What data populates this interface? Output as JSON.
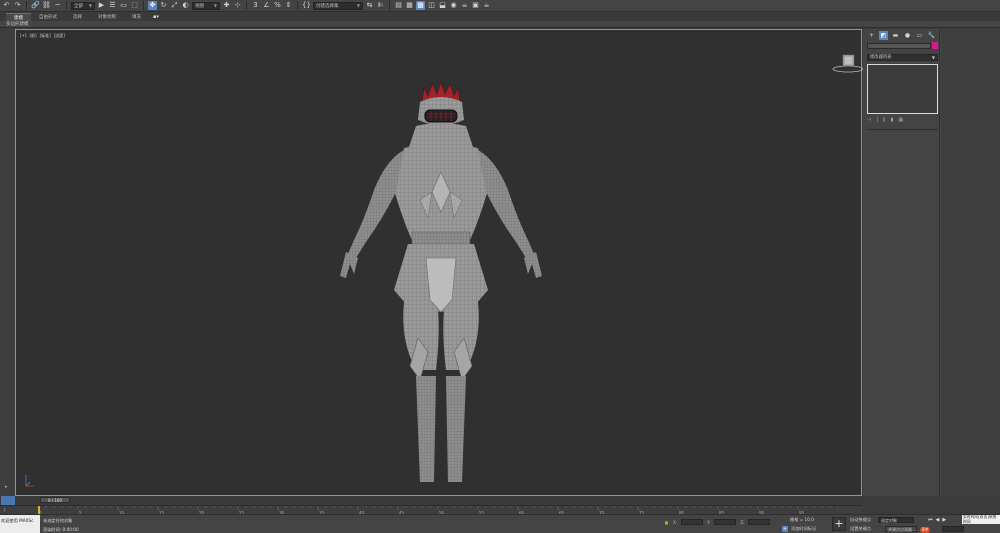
{
  "toolbar": {
    "undo": "↶",
    "redo": "↷",
    "link": "🔗",
    "unlink": "⛓",
    "bind": "~",
    "filter_dropdown": "全部",
    "select": "▶",
    "select_by_name": "☰",
    "rect_select": "▭",
    "window_crossing": "⬚",
    "move": "✥",
    "rotate": "↻",
    "scale": "⤢",
    "ref_coord_dropdown": "视图",
    "pivot": "✚",
    "select_manip": "⊹",
    "snap_3d": "3",
    "angle_snap": "∠",
    "percent_snap": "%",
    "spinner_snap": "⇕",
    "named_sel_icon": "{}",
    "named_sel_dropdown": "创建选择集",
    "mirror": "⇆",
    "align": "⊫",
    "scene_explorer": "▤",
    "layer_explorer": "▦",
    "ribbon_toggle": "▩",
    "curve_editor": "◫",
    "schematic": "⬓",
    "material_editor": "◉",
    "render_setup": "☕",
    "render_frame": "▣",
    "render": "☕"
  },
  "ribbon": {
    "tabs": [
      "建模",
      "自由形式",
      "选择",
      "对象绘制",
      "填充"
    ],
    "active_index": 0,
    "pin": "▪▾",
    "subtitle": "多边形建模"
  },
  "viewport": {
    "labels": [
      "[+]",
      "[前]",
      "[标准]",
      "[边面]"
    ],
    "border_color": "#b39a28",
    "model_color": "#9a9a9a",
    "crown_color": "#a0232a"
  },
  "command_panel": {
    "tabs": [
      "+",
      "◩",
      "▬",
      "●",
      "▭",
      "🔧"
    ],
    "active_index": 1,
    "modifier_list": "修改器列表",
    "object_color": "#d6188f",
    "stack_tools": [
      "⊣",
      "|",
      "∥",
      "▮",
      "▦"
    ]
  },
  "time_slider": {
    "frame_display": "0 / 100",
    "ruler_ticks": [
      "0",
      "5",
      "10",
      "15",
      "20",
      "25",
      "30",
      "35",
      "40",
      "45",
      "50",
      "55",
      "60",
      "65",
      "70",
      "75",
      "80",
      "85",
      "90",
      "95",
      "100"
    ],
    "key_label": "0"
  },
  "status": {
    "maxscript_line1": "欢迎使用 MAXSc",
    "maxscript_line2": "",
    "message1": "未选定任何对象",
    "message2": "渲染时间: 0:00:00",
    "x_label": "X:",
    "y_label": "Y:",
    "z_label": "Z:",
    "grid": "栅格 = 10.0",
    "add_time_tag": "添加时间标记",
    "auto_key": "自动关键点",
    "set_key": "设置关键点",
    "selected_dropdown": "选定对象",
    "key_filters": "关键点过滤器...",
    "notification": "实时时间[双击]系统时间",
    "tray_logo": "S中"
  }
}
